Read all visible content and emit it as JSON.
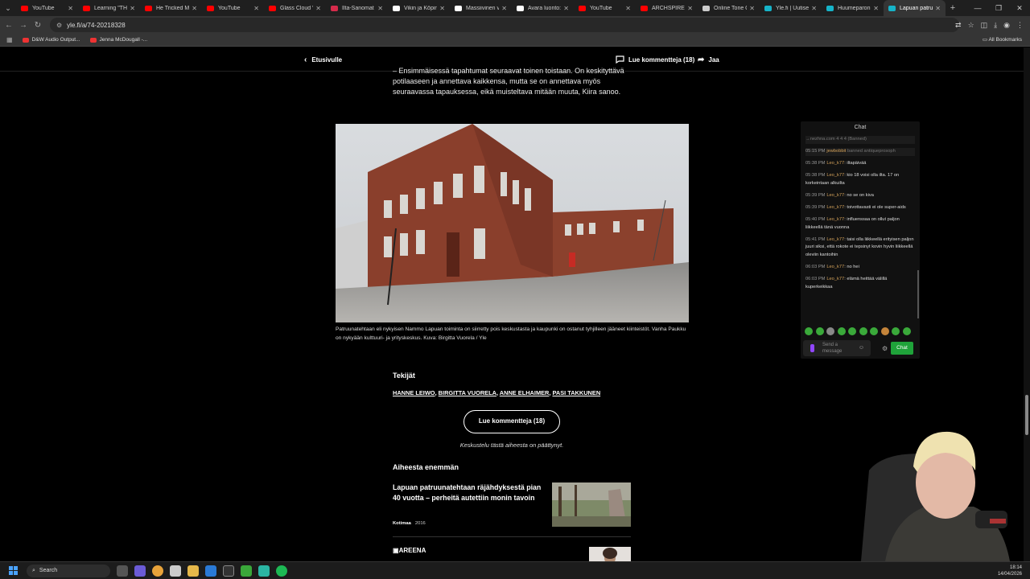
{
  "browser": {
    "tabs": [
      {
        "title": "YouTube",
        "color": "#ff0000",
        "active": false
      },
      {
        "title": "Learning \"THE",
        "color": "#ff0000",
        "active": false
      },
      {
        "title": "He Tricked Me",
        "color": "#ff0000",
        "active": false
      },
      {
        "title": "YouTube",
        "color": "#ff0000",
        "active": false
      },
      {
        "title": "Glass Cloud \"S",
        "color": "#ff0000",
        "active": false
      },
      {
        "title": "Ilta-Sanomat -",
        "color": "#d62b4b",
        "active": false
      },
      {
        "title": "Vikin ja Köpin",
        "color": "#ffffff",
        "active": false
      },
      {
        "title": "Massiivinen val",
        "color": "#ffffff",
        "active": false
      },
      {
        "title": "Avara luonto: L",
        "color": "#ffffff",
        "active": false
      },
      {
        "title": "YouTube",
        "color": "#ff0000",
        "active": false
      },
      {
        "title": "ARCHSPIRE",
        "color": "#ff0000",
        "active": false
      },
      {
        "title": "Online Tone Ge",
        "color": "#cccccc",
        "active": false
      },
      {
        "title": "Yle.fi | Uutiset,",
        "color": "#16b3c8",
        "active": false
      },
      {
        "title": "Huumeparoni",
        "color": "#16b3c8",
        "active": false
      },
      {
        "title": "Lapuan patruun",
        "color": "#16b3c8",
        "active": true
      }
    ],
    "url": "yle.fi/a/74-20218328",
    "bookmarks": [
      {
        "label": "D&W Audio Output..."
      },
      {
        "label": "Jenna McDougall -..."
      }
    ],
    "all_bookmarks": "All Bookmarks"
  },
  "site_header": {
    "back_label": "Etusivulle",
    "comments_label": "Lue kommentteja (18)",
    "share_label": "Jaa"
  },
  "article": {
    "paragraph": "– Ensimmäisessä tapahtumat seuraavat toinen toistaan. On keskityttävä potilaaseen ja annettava kaikkensa, mutta se on annettava myös seuraavassa tapauksessa, eikä muisteltava mitään muuta, Kiira sanoo.",
    "caption": "Patruunatehtaan eli nykyisen Nammo Lapuan toiminta on siirretty pois keskustasta ja kaupunki on ostanut tyhjilleen jääneet kiinteistöt. Vanha Paukku on nykyään kulttuuri- ja yrityskeskus. Kuva: Birgitta Vuorela / Yle",
    "authors_heading": "Tekijät",
    "authors": [
      "HANNE LEIWO",
      "BIRGITTA VUORELA",
      "ANNE ELHAIMER",
      "PASI TAKKUNEN"
    ],
    "read_comments_button": "Lue kommentteja (18)",
    "discussion_closed": "Keskustelu tästä aiheesta on päättynyt.",
    "related_heading": "Aiheesta enemmän",
    "related": {
      "title": "Lapuan patruunatehtaan räjähdyksestä pian 40 vuotta – perheitä autettiin monin tavoin",
      "category": "Kotimaa",
      "year": "2016"
    },
    "areena_label": "AREENA"
  },
  "chat": {
    "title": "Chat",
    "messages": [
      {
        "time": "",
        "user": "",
        "text": "→nezhna.com 4 4 4 (Banned)",
        "banned": true
      },
      {
        "time": "05:15 PM",
        "user": "jewbobbit",
        "text": "banned antiqueprosoph",
        "banned": true
      },
      {
        "time": "05:38 PM",
        "user": "Leo_k77",
        "text": "iltapäivää",
        "banned": false
      },
      {
        "time": "05:38 PM",
        "user": "Leo_k77",
        "text": "kio 18 voisi olla ilta. 17 on korkeintaan alkuilta",
        "banned": false
      },
      {
        "time": "05:39 PM",
        "user": "Leo_k77",
        "text": "no se on kiva",
        "banned": false
      },
      {
        "time": "05:39 PM",
        "user": "Leo_k77",
        "text": "toivottavasti ei ole super-aids",
        "banned": false
      },
      {
        "time": "05:40 PM",
        "user": "Leo_k77",
        "text": "influenssaa on ollut paljon liikkeellä tänä vuonna",
        "banned": false
      },
      {
        "time": "05:41 PM",
        "user": "Leo_k77",
        "text": "taisi olla liikkeellä erityisen paljon juuri siksi, että rokote ei tepsinyt kovin hyvin liikkeellä oleviin kantoihin",
        "banned": false
      },
      {
        "time": "06:03 PM",
        "user": "Leo_k77",
        "text": "no hei",
        "banned": false
      },
      {
        "time": "06:03 PM",
        "user": "Leo_k77",
        "text": "elämä heittää välillä kuperkeikkaa",
        "banned": false
      }
    ],
    "input_placeholder": "Send a message",
    "send_label": "Chat"
  },
  "taskbar": {
    "search_placeholder": "Search",
    "time": "18:14",
    "date": "14/04/2026"
  },
  "colors": {
    "accent_chat": "#1fa33a",
    "tab_active": "#353535"
  }
}
